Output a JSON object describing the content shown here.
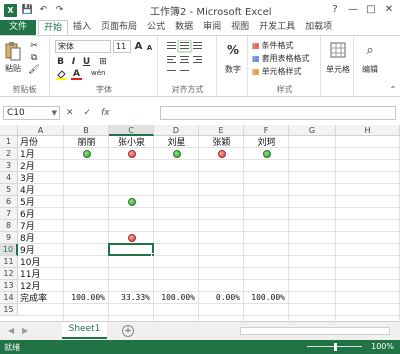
{
  "window": {
    "title": "工作簿2 - Microsoft Excel",
    "logo": "X",
    "help": "?",
    "minimize": "—",
    "restore": "□",
    "close": "✕"
  },
  "quick_access": {
    "save": "💾",
    "undo": "↶",
    "redo": "↷"
  },
  "tabs": [
    "文件",
    "开始",
    "插入",
    "页面布局",
    "公式",
    "数据",
    "审阅",
    "视图",
    "开发工具",
    "加载项"
  ],
  "ribbon": {
    "clipboard": {
      "paste_label": "粘贴",
      "group_label": "剪贴板"
    },
    "font": {
      "font_name": "宋体",
      "font_size": "11",
      "bold": "B",
      "italic": "I",
      "underline": "U",
      "grow": "A",
      "shrink": "A",
      "wen": "wén",
      "font_color_glyph": "A",
      "group_label": "字体"
    },
    "alignment": {
      "group_label": "对齐方式"
    },
    "number": {
      "percent": "%",
      "label": "数字"
    },
    "styles": {
      "conditional": "条件格式",
      "table": "套用表格格式",
      "cell_styles": "单元格样式",
      "group_label": "样式"
    },
    "cells": {
      "label": "单元格"
    },
    "editing": {
      "label": "编辑"
    }
  },
  "formula_bar": {
    "name_box": "C10",
    "cancel": "✕",
    "enter": "✓",
    "fx": "fx",
    "formula": ""
  },
  "grid": {
    "columns": [
      "A",
      "B",
      "C",
      "D",
      "E",
      "F",
      "G",
      "H"
    ],
    "selected_column": "C",
    "rows": [
      "1",
      "2",
      "3",
      "4",
      "5",
      "6",
      "7",
      "8",
      "9",
      "10",
      "11",
      "12",
      "13",
      "14",
      "15"
    ],
    "selected_row": "10",
    "header_row": [
      "月份",
      "丽丽",
      "张小泉",
      "刘星",
      "张颖",
      "刘珂"
    ],
    "months": [
      "1月",
      "2月",
      "3月",
      "4月",
      "5月",
      "6月",
      "7月",
      "8月",
      "9月",
      "10月",
      "11月",
      "12月"
    ],
    "total_label": "完成率",
    "totals": [
      "100.00%",
      "33.33%",
      "100.00%",
      "0.00%",
      "100.00%"
    ],
    "markers": [
      {
        "row": 2,
        "col": "B",
        "status": "green"
      },
      {
        "row": 2,
        "col": "C",
        "status": "red"
      },
      {
        "row": 2,
        "col": "D",
        "status": "green"
      },
      {
        "row": 2,
        "col": "E",
        "status": "red"
      },
      {
        "row": 2,
        "col": "F",
        "status": "green"
      },
      {
        "row": 6,
        "col": "C",
        "status": "green"
      },
      {
        "row": 9,
        "col": "C",
        "status": "red"
      }
    ],
    "colors": {
      "green": "#2f9a2a",
      "red": "#d43a3a",
      "accent": "#217346"
    }
  },
  "sheets": {
    "tabs": [
      "Sheet1"
    ],
    "add": "+",
    "prev": "◀",
    "next": "▶"
  },
  "status_bar": {
    "ready": "就绪",
    "zoom": "100%"
  }
}
